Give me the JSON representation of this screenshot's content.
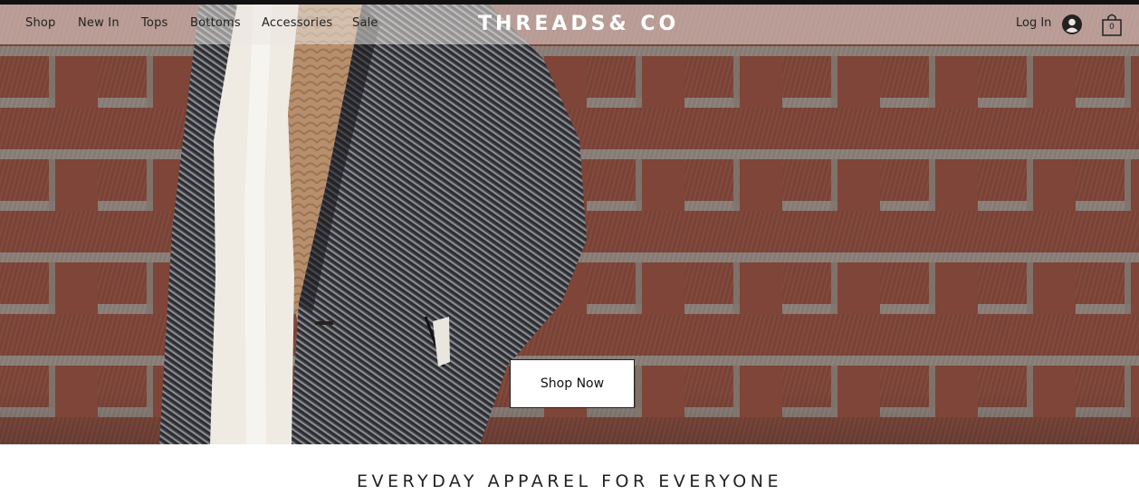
{
  "nav": {
    "links": [
      "Shop",
      "New In",
      "Tops",
      "Bottoms",
      "Accessories",
      "Sale"
    ],
    "logo": "THREADS& CO",
    "login_label": "Log In",
    "cart_count": "0"
  },
  "hero": {
    "cta_label": "Shop Now"
  },
  "tagline": "EVERYDAY APPAREL FOR EVERYONE",
  "colors": {
    "brick": "#7e4538",
    "mortar": "#8b8079",
    "nav_bg": "#ebe6e2",
    "text": "#222222",
    "logo": "#ffffff"
  },
  "icons": {
    "account": "user-circle-icon",
    "cart": "shopping-bag-icon"
  }
}
